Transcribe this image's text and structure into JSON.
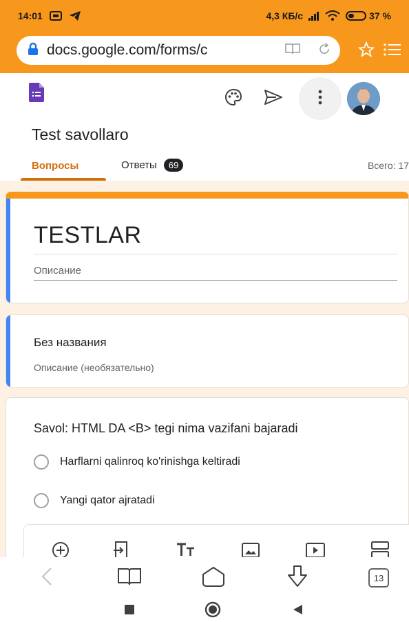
{
  "status_bar": {
    "time": "14:01",
    "network_speed": "4,3 КБ/с",
    "battery_text": "37 %",
    "battery_level": 0.37
  },
  "browser": {
    "url": "docs.google.com/forms/c",
    "tab_count": "13"
  },
  "form": {
    "name": "Test savollaro",
    "tabs": {
      "questions": "Вопросы",
      "answers": "Ответы",
      "answers_count": "69",
      "total": "Всего: 17"
    },
    "title_card": {
      "title": "TESTLAR",
      "description_placeholder": "Описание"
    },
    "section_card": {
      "title": "Без названия",
      "description_placeholder": "Описание (необязательно)"
    },
    "question_card": {
      "question": "Savol: HTML DA <B> tegi nima vazifani bajaradi",
      "options": [
        "Harflarni qalinroq ko'rinishga keltiradi",
        "Yangi qator ajratadi"
      ]
    },
    "toolbar_icons": [
      "add-question-icon",
      "import-questions-icon",
      "add-title-icon",
      "add-image-icon",
      "add-video-icon",
      "add-section-icon"
    ]
  },
  "colors": {
    "header_orange": "#f7981d",
    "accent_orange": "#d56e0c",
    "focus_blue": "#4285f4",
    "forms_purple": "#673ab7",
    "canvas_bg": "#fdf1e4"
  }
}
